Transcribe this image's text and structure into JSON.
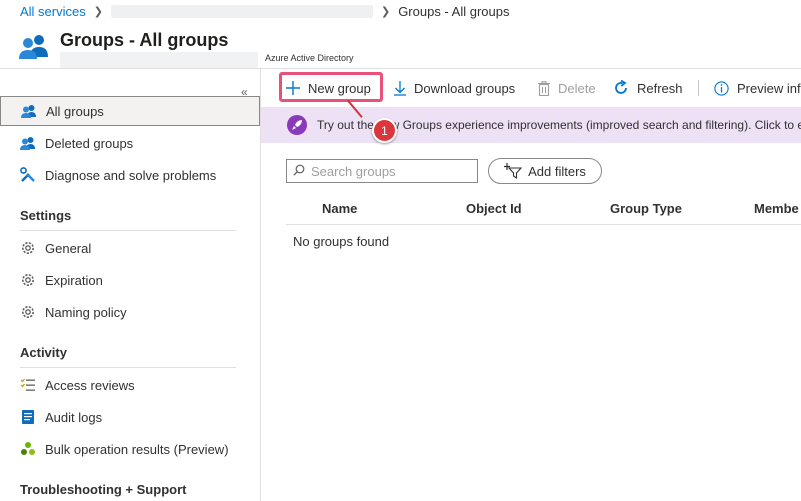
{
  "breadcrumb": {
    "root": "All services",
    "current": "Groups - All groups"
  },
  "header": {
    "title": "Groups - All groups",
    "subtitle": "Azure Active Directory"
  },
  "sidebar": {
    "collapse_glyph": "«",
    "items": [
      {
        "label": "All groups",
        "icon": "users-icon",
        "active": true
      },
      {
        "label": "Deleted groups",
        "icon": "users-icon"
      },
      {
        "label": "Diagnose and solve problems",
        "icon": "wrench-icon"
      }
    ],
    "sections": [
      {
        "heading": "Settings",
        "items": [
          {
            "label": "General",
            "icon": "gear-icon"
          },
          {
            "label": "Expiration",
            "icon": "gear-icon"
          },
          {
            "label": "Naming policy",
            "icon": "gear-icon"
          }
        ]
      },
      {
        "heading": "Activity",
        "items": [
          {
            "label": "Access reviews",
            "icon": "list-check-icon"
          },
          {
            "label": "Audit logs",
            "icon": "log-icon"
          },
          {
            "label": "Bulk operation results (Preview)",
            "icon": "bulk-icon"
          }
        ]
      },
      {
        "heading": "Troubleshooting + Support",
        "items": []
      }
    ]
  },
  "toolbar": {
    "new_group": "New group",
    "download_groups": "Download groups",
    "delete": "Delete",
    "refresh": "Refresh",
    "preview_info": "Preview inf"
  },
  "banner": {
    "text": "Try out the new Groups experience improvements (improved search and filtering). Click to en"
  },
  "callout": {
    "step": "1"
  },
  "search": {
    "placeholder": "Search groups",
    "value": ""
  },
  "filters": {
    "add_label": "Add filters"
  },
  "table": {
    "columns": [
      "Name",
      "Object Id",
      "Group Type",
      "Membe"
    ],
    "empty_message": "No groups found"
  },
  "colors": {
    "accent": "#0078d4",
    "highlight": "#e8527a",
    "badge": "#d9363e",
    "banner_bg": "#ece1f5",
    "banner_icon": "#8a3ab9"
  }
}
